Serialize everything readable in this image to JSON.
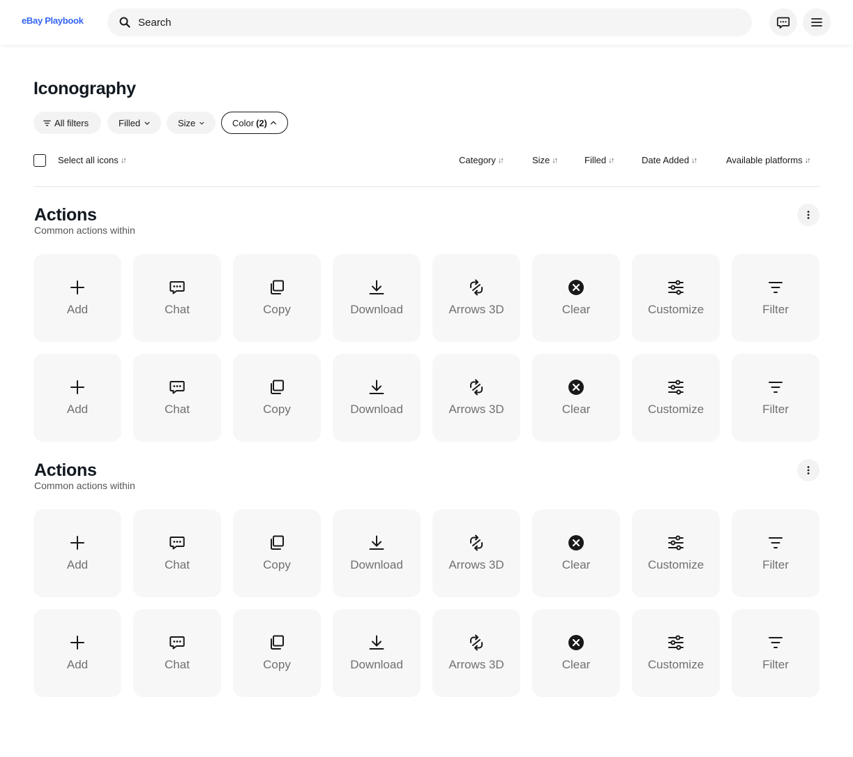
{
  "header": {
    "logo": "eBay Playbook",
    "search_placeholder": "Search",
    "icons": {
      "search": "search-icon",
      "chat": "chat-icon",
      "menu": "hamburger-menu-icon"
    }
  },
  "page": {
    "title": "Iconography"
  },
  "filters": [
    {
      "label": "All filters",
      "icon": "filter-icon"
    },
    {
      "label": "Filled",
      "icon": "chevron-down-icon"
    },
    {
      "label": "Size",
      "icon": "chevron-down-icon"
    },
    {
      "label": "Color",
      "count": "(2)",
      "icon": "chevron-up-icon",
      "active": true
    }
  ],
  "sortbar": {
    "select_all": "Select all icons",
    "columns": [
      "Category",
      "Size",
      "Filled",
      "Date Added",
      "Available platforms"
    ]
  },
  "sections": [
    {
      "title": "Actions",
      "subtitle": "Common actions within",
      "rows": [
        [
          "Add",
          "Chat",
          "Copy",
          "Download",
          "Arrows 3D",
          "Clear",
          "Customize",
          "Filter"
        ],
        [
          "Add",
          "Chat",
          "Copy",
          "Download",
          "Arrows 3D",
          "Clear",
          "Customize",
          "Filter"
        ]
      ]
    },
    {
      "title": "Actions",
      "subtitle": "Common actions within",
      "rows": [
        [
          "Add",
          "Chat",
          "Copy",
          "Download",
          "Arrows 3D",
          "Clear",
          "Customize",
          "Filter"
        ],
        [
          "Add",
          "Chat",
          "Copy",
          "Download",
          "Arrows 3D",
          "Clear",
          "Customize",
          "Filter"
        ]
      ]
    }
  ],
  "tile_icons": [
    "add-icon",
    "chat-icon",
    "copy-icon",
    "download-icon",
    "arrows-3d-icon",
    "clear-icon",
    "customize-icon",
    "filter-icon"
  ],
  "colors": {
    "brand": "#3665f3",
    "text": "#191919",
    "tile_bg": "#f7f7f7",
    "chip_bg": "#f3f3f3",
    "muted": "#707070"
  }
}
